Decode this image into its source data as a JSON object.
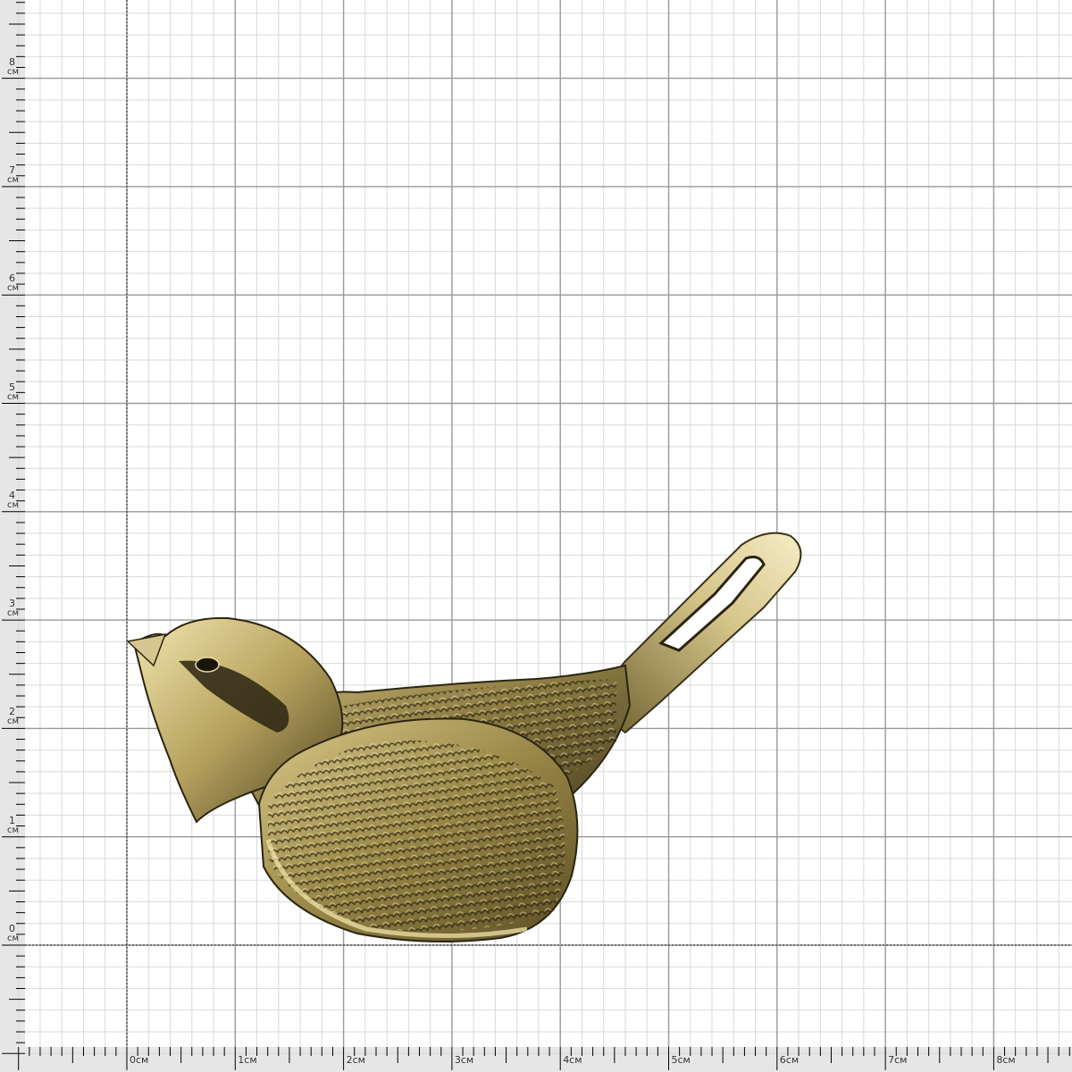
{
  "ruler": {
    "unit": "см",
    "vertical_labels": [
      "8",
      "7",
      "6",
      "5",
      "4",
      "3",
      "2",
      "1",
      "0"
    ],
    "horizontal_labels": [
      "0см",
      "1см",
      "2см",
      "3см",
      "4см",
      "5см",
      "6см",
      "7см",
      "8см"
    ]
  },
  "object": {
    "icon": "bird-figurine-icon",
    "colors": {
      "bronze_light": "#f3e6b0",
      "bronze_mid": "#b6a25e",
      "bronze_dark": "#3a3218",
      "bronze_shadow": "#1e1a0c"
    }
  },
  "colors": {
    "grid_minor": "#d9d9d9",
    "grid_major": "#9a9a9a",
    "ruler_bg": "#e6e6e6",
    "ruler_ink": "#000000"
  }
}
